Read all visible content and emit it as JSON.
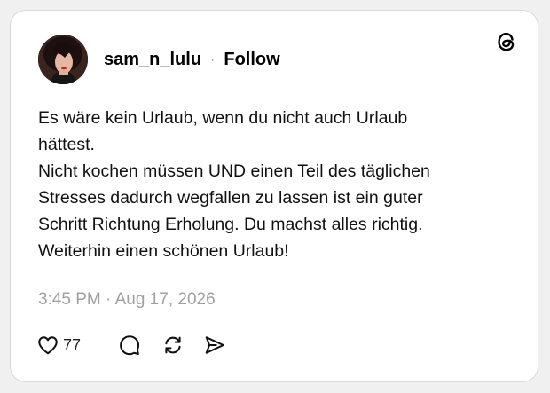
{
  "post": {
    "username": "sam_n_lulu",
    "separator": "·",
    "follow_label": "Follow",
    "text_lines": [
      "Es wäre kein Urlaub, wenn du nicht auch Urlaub",
      "hättest.",
      "Nicht kochen müssen UND einen Teil des täglichen",
      "Stresses dadurch wegfallen zu lassen ist ein guter",
      "Schritt Richtung Erholung. Du machst alles richtig.",
      "Weiterhin einen schönen Urlaub!"
    ],
    "timestamp": "3:45 PM · Aug 17, 2026",
    "like_count": "77"
  },
  "icons": {
    "logo": "threads-logo-icon",
    "like": "heart-icon",
    "reply": "comment-icon",
    "repost": "repost-icon",
    "share": "send-icon"
  },
  "colors": {
    "card_background": "#ffffff",
    "page_background": "#f0f0f0",
    "timestamp": "#a0a0a0",
    "text": "#111111"
  }
}
